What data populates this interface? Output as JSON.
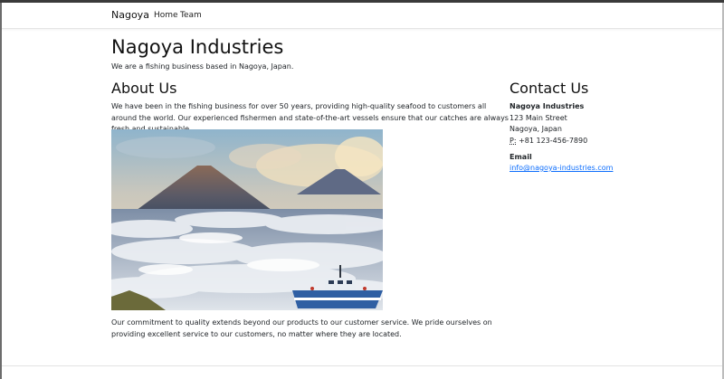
{
  "nav": {
    "brand": "Nagoya",
    "links": [
      {
        "label": "Home"
      },
      {
        "label": "Team"
      }
    ]
  },
  "hero": {
    "title": "Nagoya Industries",
    "tagline": "We are a fishing business based in Nagoya, Japan."
  },
  "about": {
    "heading": "About Us",
    "paragraph1": "We have been in the fishing business for over 50 years, providing high-quality seafood to customers all around the world. Our experienced fishermen and state-of-the-art vessels ensure that our catches are always fresh and sustainable.",
    "paragraph2": "Our commitment to quality extends beyond our products to our customer service. We pride ourselves on providing excellent service to our customers, no matter where they are located."
  },
  "contact": {
    "heading": "Contact Us",
    "company": "Nagoya Industries",
    "street": "123 Main Street",
    "city": "Nagoya, Japan",
    "phone_label": "P:",
    "phone": "+81 123-456-7890",
    "email_label": "Email",
    "email": "info@nagoya-industries.com"
  },
  "colors": {
    "link": "#0d6efd",
    "text": "#212529",
    "navbar_bg": "#ffffff"
  },
  "icons": {
    "photo": "mountains-above-clouds-with-fishing-boat"
  }
}
